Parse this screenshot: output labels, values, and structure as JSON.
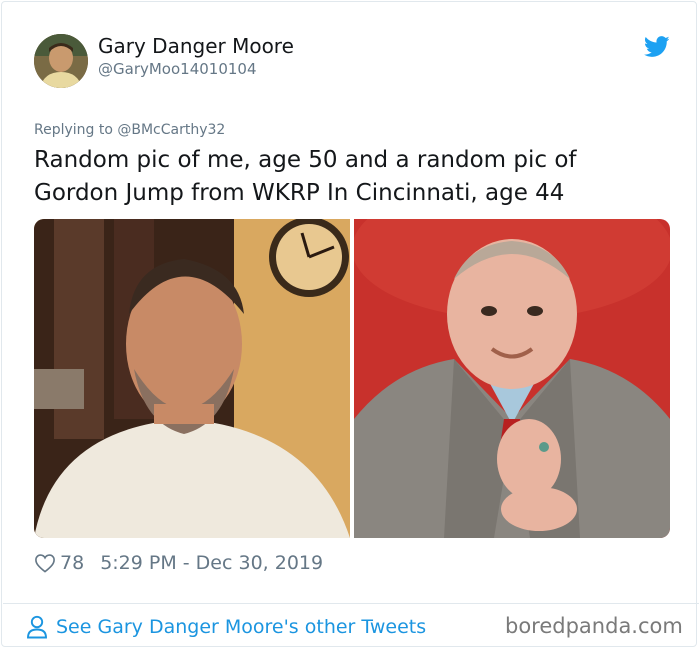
{
  "author": {
    "name": "Gary Danger Moore",
    "handle": "@GaryMoo14010104",
    "avatar_icon": "user-avatar"
  },
  "reply": {
    "text": "Replying to @BMcCarthy32"
  },
  "tweet": {
    "text": "Random pic of me, age 50 and a random pic of Gordon Jump from WKRP In Cincinnati, age 44"
  },
  "meta": {
    "likes": "78",
    "timestamp": "5:29 PM - Dec 30, 2019",
    "heart_icon": "heart-outline"
  },
  "footer": {
    "other_tweets_link": "See Gary Danger Moore's other Tweets",
    "person_icon": "person-outline"
  },
  "watermark": "boredpanda.com",
  "colors": {
    "twitter_blue": "#1da1f2",
    "link_blue": "#1b95e0",
    "muted_text": "#657786",
    "red_backdrop": "#c8312c"
  }
}
